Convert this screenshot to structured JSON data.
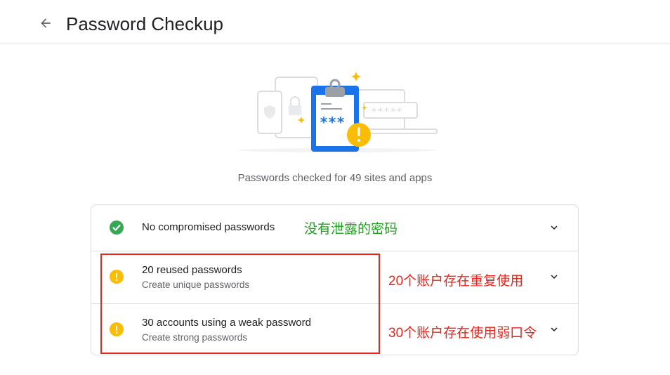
{
  "header": {
    "title": "Password Checkup",
    "back_icon": "arrow-left-icon"
  },
  "summary": "Passwords checked for 49 sites and apps",
  "illustration": {
    "masked_password": "*****",
    "clipboard_password": "***"
  },
  "results": [
    {
      "title": "No compromised passwords",
      "subtitle": "",
      "status": "ok",
      "icon": "check-circle-icon",
      "color": "#34a853"
    },
    {
      "title": "20 reused passwords",
      "subtitle": "Create unique passwords",
      "status": "warning",
      "icon": "warning-circle-icon",
      "color": "#fbbc04"
    },
    {
      "title": "30 accounts using a weak password",
      "subtitle": "Create strong passwords",
      "status": "warning",
      "icon": "warning-circle-icon",
      "color": "#fbbc04"
    }
  ],
  "annotations": {
    "no_compromised": "没有泄露的密码",
    "reused": "20个账户存在重复使用",
    "weak": "30个账户存在使用弱口令",
    "green_color": "#1ea41e",
    "red_color": "#e8261c"
  }
}
